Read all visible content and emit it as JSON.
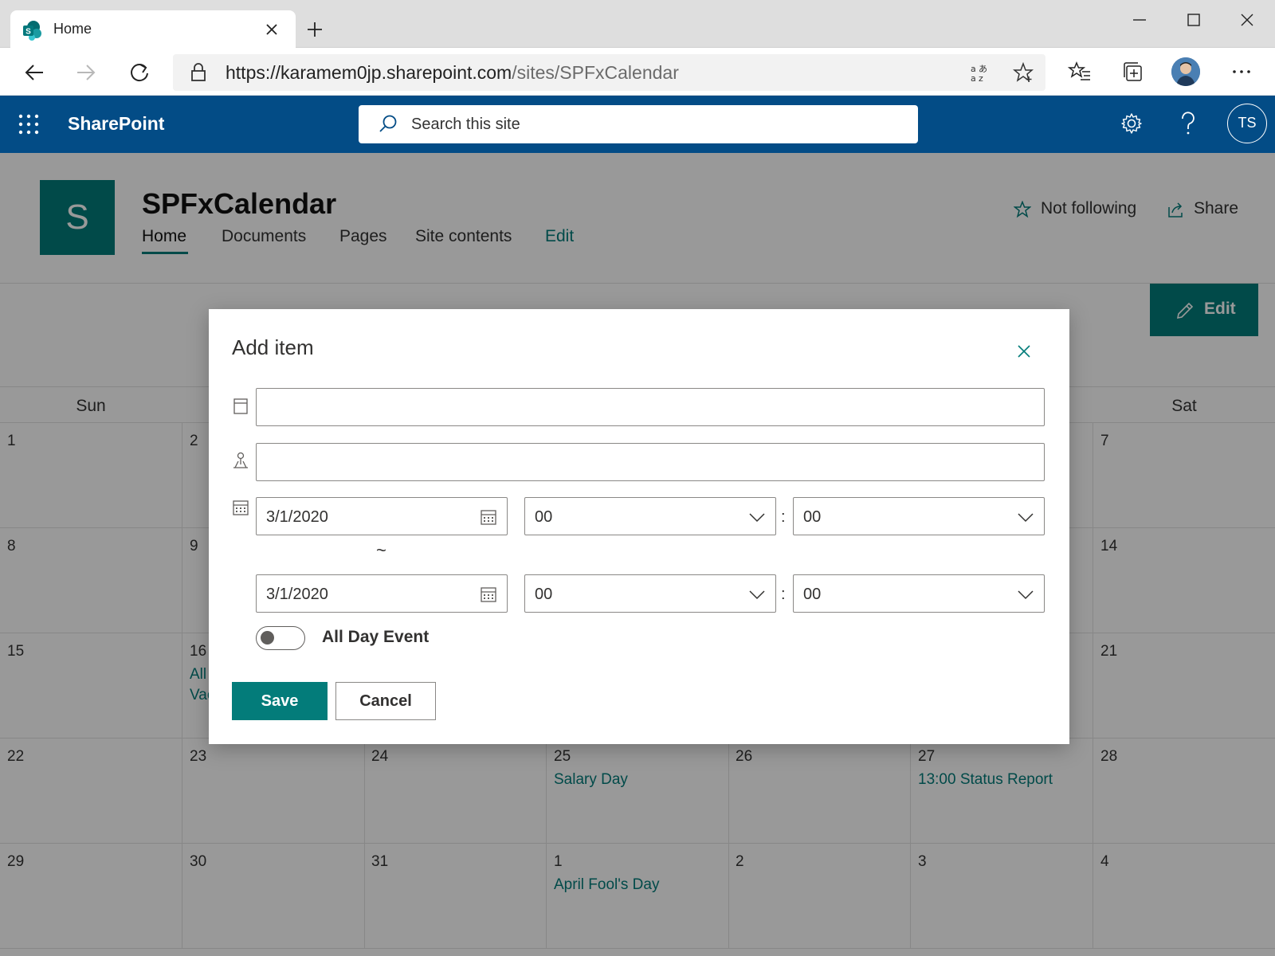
{
  "browser": {
    "tab_title": "Home",
    "url_host": "https://karamem0jp.sharepoint.com",
    "url_path": "/sites/SPFxCalendar"
  },
  "suitebar": {
    "app_name": "SharePoint",
    "search_placeholder": "Search this site",
    "user_initials": "TS"
  },
  "site": {
    "logo_letter": "S",
    "title": "SPFxCalendar",
    "nav": [
      "Home",
      "Documents",
      "Pages",
      "Site contents",
      "Edit"
    ],
    "follow_label": "Not following",
    "share_label": "Share",
    "edit_label": "Edit"
  },
  "calendar": {
    "day_names": [
      "Sun",
      "",
      "",
      "",
      "",
      "",
      "Sat"
    ],
    "weeks": [
      [
        {
          "d": "1"
        },
        {
          "d": "2"
        },
        {
          "d": ""
        },
        {
          "d": ""
        },
        {
          "d": ""
        },
        {
          "d": ""
        },
        {
          "d": "7"
        }
      ],
      [
        {
          "d": "8"
        },
        {
          "d": "9"
        },
        {
          "d": ""
        },
        {
          "d": ""
        },
        {
          "d": ""
        },
        {
          "d": ""
        },
        {
          "d": "14"
        }
      ],
      [
        {
          "d": "15"
        },
        {
          "d": "16",
          "e1": "All",
          "e2": "Vac"
        },
        {
          "d": ""
        },
        {
          "d": ""
        },
        {
          "d": ""
        },
        {
          "d": ""
        },
        {
          "d": "21"
        }
      ],
      [
        {
          "d": "22"
        },
        {
          "d": "23"
        },
        {
          "d": "24"
        },
        {
          "d": "25",
          "e1": "Salary Day"
        },
        {
          "d": "26"
        },
        {
          "d": "27",
          "e1": "13:00 Status Report"
        },
        {
          "d": "28"
        }
      ],
      [
        {
          "d": "29"
        },
        {
          "d": "30"
        },
        {
          "d": "31"
        },
        {
          "d": "1",
          "e1": "April Fool's Day"
        },
        {
          "d": "2"
        },
        {
          "d": "3"
        },
        {
          "d": "4"
        }
      ]
    ]
  },
  "dialog": {
    "title": "Add item",
    "title_value": "",
    "location_value": "",
    "start_date": "3/1/2020",
    "start_hour": "00",
    "start_minute": "00",
    "separator": "~",
    "time_colon": ":",
    "end_date": "3/1/2020",
    "end_hour": "00",
    "end_minute": "00",
    "all_day_label": "All Day Event",
    "all_day_on": false,
    "save_label": "Save",
    "cancel_label": "Cancel"
  },
  "colors": {
    "brand_teal": "#037c7a",
    "suitebar_blue": "#034c86"
  }
}
